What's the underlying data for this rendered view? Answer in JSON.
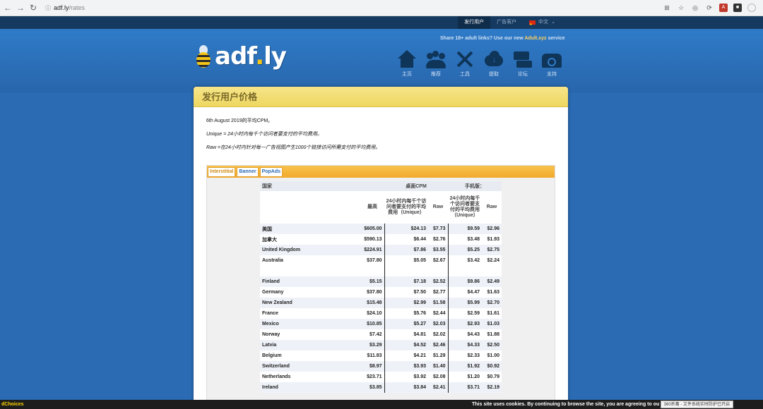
{
  "browser": {
    "url_host": "adf.ly",
    "url_path": "/rates",
    "ext_icons": [
      "translate-icon",
      "star-icon",
      "extension-icon",
      "refresh-ext-icon",
      "pdf-icon",
      "account-icon",
      "profile-icon"
    ]
  },
  "topbar": {
    "publisher_tab": "发行用户",
    "advertiser_tab": "广告客户",
    "language": "中文",
    "language_chevron": "⌄"
  },
  "header": {
    "share_prefix": "Share 18+ adult links? Use our new ",
    "share_link": "Adult.xyz",
    "share_suffix": " service",
    "logo_text": "adf",
    "logo_dot": ".",
    "logo_tail": "ly",
    "nav": [
      {
        "label": "主页",
        "icon": "home-icon"
      },
      {
        "label": "推荐",
        "icon": "people-icon"
      },
      {
        "label": "工具",
        "icon": "tools-icon"
      },
      {
        "label": "提取",
        "icon": "cloud-download-icon"
      },
      {
        "label": "论坛",
        "icon": "forum-icon"
      },
      {
        "label": "支持",
        "icon": "phone-icon"
      }
    ]
  },
  "content": {
    "title": "发行用户价格",
    "intro_date": "6th August 2019的平均CPM。",
    "intro_unique": "Unique = 24小时内每千个访问者要支付的平均费用。",
    "intro_raw": "Raw =在24小时内针对每一广告视图产生1000个链接访问所需支付的平均费用。"
  },
  "tabs": [
    {
      "label": "Interstitial",
      "active": true
    },
    {
      "label": "Banner",
      "active": false
    },
    {
      "label": "PopAds",
      "active": false
    }
  ],
  "table": {
    "h_country": "国家",
    "h_desktop": "桌面CPM",
    "h_mobile": "手机版：",
    "h_max": "最高",
    "h_unique_desktop": "24小时内每千个访问者要支付的平均费用（Unique）",
    "h_raw_desktop": "Raw",
    "h_unique_mobile": "24小时内每千个访问者要支付的平均费用（Unique）",
    "h_raw_mobile": "Raw",
    "rows": [
      {
        "country": "美国",
        "max": "$605.00",
        "d_unique": "$24.13",
        "d_raw": "$7.73",
        "m_unique": "$9.59",
        "m_raw": "$2.96"
      },
      {
        "country": "加拿大",
        "max": "$590.13",
        "d_unique": "$6.44",
        "d_raw": "$2.76",
        "m_unique": "$3.48",
        "m_raw": "$1.93"
      },
      {
        "country": "United Kingdom",
        "max": "$224.91",
        "d_unique": "$7.86",
        "d_raw": "$3.55",
        "m_unique": "$5.25",
        "m_raw": "$2.75"
      },
      {
        "country": "Australia",
        "max": "$37.80",
        "d_unique": "$5.05",
        "d_raw": "$2.67",
        "m_unique": "$3.42",
        "m_raw": "$2.24"
      },
      {
        "gap": true
      },
      {
        "country": "Finland",
        "max": "$5.15",
        "d_unique": "$7.18",
        "d_raw": "$2.52",
        "m_unique": "$9.86",
        "m_raw": "$2.49"
      },
      {
        "country": "Germany",
        "max": "$37.80",
        "d_unique": "$7.50",
        "d_raw": "$2.77",
        "m_unique": "$4.47",
        "m_raw": "$1.63"
      },
      {
        "country": "New Zealand",
        "max": "$15.48",
        "d_unique": "$2.99",
        "d_raw": "$1.58",
        "m_unique": "$5.99",
        "m_raw": "$2.70"
      },
      {
        "country": "France",
        "max": "$24.10",
        "d_unique": "$5.76",
        "d_raw": "$2.44",
        "m_unique": "$2.59",
        "m_raw": "$1.61"
      },
      {
        "country": "Mexico",
        "max": "$10.85",
        "d_unique": "$5.27",
        "d_raw": "$2.03",
        "m_unique": "$2.93",
        "m_raw": "$1.03"
      },
      {
        "country": "Norway",
        "max": "$7.42",
        "d_unique": "$4.81",
        "d_raw": "$2.02",
        "m_unique": "$4.43",
        "m_raw": "$1.88"
      },
      {
        "country": "Latvia",
        "max": "$3.29",
        "d_unique": "$4.52",
        "d_raw": "$2.46",
        "m_unique": "$4.33",
        "m_raw": "$2.50"
      },
      {
        "country": "Belgium",
        "max": "$11.83",
        "d_unique": "$4.21",
        "d_raw": "$1.29",
        "m_unique": "$2.33",
        "m_raw": "$1.00"
      },
      {
        "country": "Switzerland",
        "max": "$8.97",
        "d_unique": "$3.93",
        "d_raw": "$1.40",
        "m_unique": "$1.92",
        "m_raw": "$0.92"
      },
      {
        "country": "Netherlands",
        "max": "$23.71",
        "d_unique": "$3.92",
        "d_raw": "$2.08",
        "m_unique": "$1.20",
        "m_raw": "$0.79"
      },
      {
        "country": "Ireland",
        "max": "$3.85",
        "d_unique": "$3.84",
        "d_raw": "$2.41",
        "m_unique": "$3.71",
        "m_raw": "$2.19"
      }
    ]
  },
  "bottom": {
    "adchoices": "dChoices",
    "cookie": "This site uses cookies. By continuing to browse the site, you are agreeing to ou",
    "toast": "360杀毒 - 文件系统实时防护已开启"
  },
  "colors": {
    "page_blue": "#2a6bb3",
    "topbar": "#16395f",
    "card_header": "#eed760",
    "tab_bar": "#f2a92c"
  }
}
